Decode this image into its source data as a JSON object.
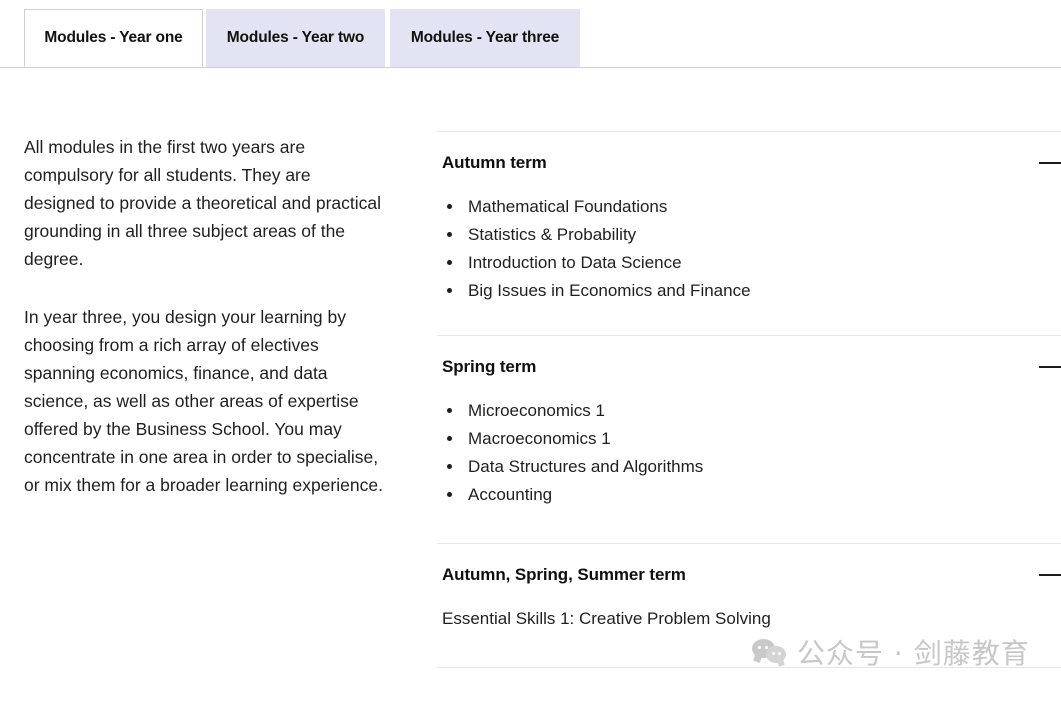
{
  "tabs": [
    {
      "label": "Modules - Year one",
      "active": true
    },
    {
      "label": "Modules - Year two",
      "active": false
    },
    {
      "label": "Modules - Year three",
      "active": false
    }
  ],
  "intro": {
    "paragraph_1": "All modules in the first two years are compulsory for all students. They are designed to provide a theoretical and practical grounding in all three subject areas of the degree.",
    "paragraph_2": "In year three, you design your learning by choosing from a rich array of electives spanning economics, finance, and data science, as well as other areas of expertise offered by the Business School. You may concentrate in one area in order to specialise, or mix them for a broader learning experience."
  },
  "accordion": {
    "toggle_icon": "minus-icon",
    "sections": [
      {
        "title": "Autumn term",
        "items": [
          "Mathematical Foundations",
          "Statistics & Probability",
          "Introduction to Data Science",
          "Big Issues in Economics and Finance"
        ]
      },
      {
        "title": "Spring term",
        "items": [
          "Microeconomics 1",
          "Macroeconomics 1",
          "Data Structures and Algorithms",
          "Accounting"
        ]
      },
      {
        "title": "Autumn, Spring, Summer term",
        "text": "Essential Skills 1: Creative Problem Solving"
      }
    ]
  },
  "watermark": {
    "icon": "wechat-icon",
    "text": "公众号 · 剑藤教育"
  },
  "colors": {
    "tab_inactive_bg": "#e2e3f3",
    "tab_active_bg": "#ffffff",
    "tab_border": "#cfcfd4",
    "divider": "#e6e6e9",
    "text": "#1f1f1f",
    "watermark_text": "#c7c7c7"
  }
}
